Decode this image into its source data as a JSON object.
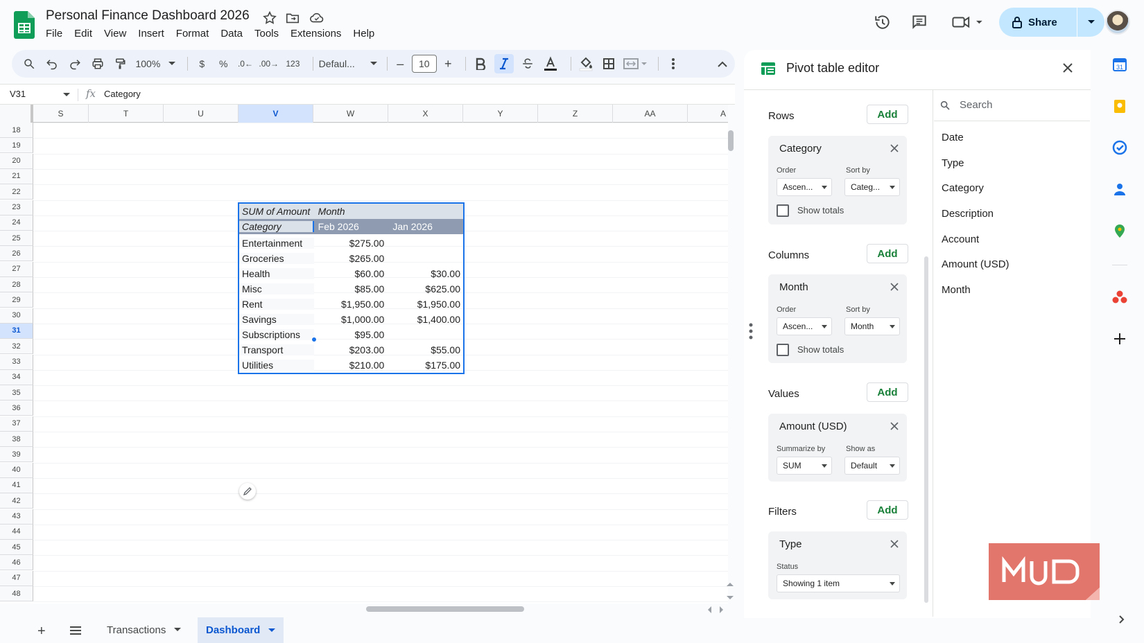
{
  "app": {
    "title": "Personal Finance Dashboard 2026",
    "menu": [
      "File",
      "Edit",
      "View",
      "Insert",
      "Format",
      "Data",
      "Tools",
      "Extensions",
      "Help"
    ],
    "share_label": "Share"
  },
  "toolbar": {
    "zoom": "100%",
    "currency": "$",
    "percent": "%",
    "dec_decrease": ".0",
    "dec_increase": ".00",
    "number_format": "123",
    "font": "Defaul...",
    "font_size": "10",
    "minus": "–",
    "plus": "+"
  },
  "formula_bar": {
    "cell_ref": "V31",
    "fx": "fx",
    "content": "Category"
  },
  "grid": {
    "columns": [
      "S",
      "T",
      "U",
      "V",
      "W",
      "X",
      "Y",
      "Z",
      "AA",
      "A"
    ],
    "selected_column": "V",
    "rows": [
      "18",
      "19",
      "20",
      "21",
      "22",
      "23",
      "24",
      "25",
      "26",
      "27",
      "28",
      "29",
      "30",
      "31",
      "32",
      "33",
      "34",
      "35",
      "36",
      "37",
      "38",
      "39",
      "40",
      "41",
      "42",
      "43",
      "44",
      "45",
      "46",
      "47",
      "48"
    ],
    "selected_row": "31"
  },
  "pivot": {
    "header1": {
      "c0": "SUM of Amount",
      "c1": "Month",
      "c2": ""
    },
    "header2": {
      "c0": "Category",
      "c1": "Feb 2026",
      "c2": "Jan 2026"
    },
    "rows": [
      {
        "category": "Entertainment",
        "feb": "$275.00",
        "jan": ""
      },
      {
        "category": "Groceries",
        "feb": "$265.00",
        "jan": ""
      },
      {
        "category": "Health",
        "feb": "$60.00",
        "jan": "$30.00"
      },
      {
        "category": "Misc",
        "feb": "$85.00",
        "jan": "$625.00"
      },
      {
        "category": "Rent",
        "feb": "$1,950.00",
        "jan": "$1,950.00"
      },
      {
        "category": "Savings",
        "feb": "$1,000.00",
        "jan": "$1,400.00"
      },
      {
        "category": "Subscriptions",
        "feb": "$95.00",
        "jan": ""
      },
      {
        "category": "Transport",
        "feb": "$203.00",
        "jan": "$55.00"
      },
      {
        "category": "Utilities",
        "feb": "$210.00",
        "jan": "$175.00"
      }
    ]
  },
  "sheets": {
    "tabs": [
      "Transactions",
      "Dashboard"
    ],
    "active": "Dashboard",
    "add": "+"
  },
  "editor": {
    "title": "Pivot table editor",
    "add_label": "Add",
    "rows": {
      "label": "Rows",
      "field": "Category",
      "order_label": "Order",
      "order": "Ascen...",
      "sort_label": "Sort by",
      "sort": "Categ...",
      "show_totals": "Show totals"
    },
    "columns": {
      "label": "Columns",
      "field": "Month",
      "order_label": "Order",
      "order": "Ascen...",
      "sort_label": "Sort by",
      "sort": "Month",
      "show_totals": "Show totals"
    },
    "values": {
      "label": "Values",
      "field": "Amount (USD)",
      "summarize_label": "Summarize by",
      "summarize": "SUM",
      "show_as_label": "Show as",
      "show_as": "Default"
    },
    "filters": {
      "label": "Filters",
      "field": "Type",
      "status_label": "Status",
      "status": "Showing 1 item"
    },
    "search_placeholder": "Search",
    "fields": [
      "Date",
      "Type",
      "Category",
      "Description",
      "Account",
      "Amount (USD)",
      "Month"
    ]
  },
  "colors": {
    "accent": "#0b57d0",
    "share_bg": "#c2e7ff",
    "add_green": "#188038",
    "selection": "#1a73e8"
  },
  "icons": [
    "sheets-logo-icon",
    "star-icon",
    "move-folder-icon",
    "cloud-status-icon",
    "history-icon",
    "comment-icon",
    "meet-icon",
    "lock-icon",
    "search-icon",
    "undo-icon",
    "redo-icon",
    "print-icon",
    "paint-format-icon",
    "bold-icon",
    "italic-icon",
    "strikethrough-icon",
    "text-color-icon",
    "fill-color-icon",
    "borders-icon",
    "merge-icon",
    "more-icon",
    "collapse-icon",
    "close-icon",
    "pivot-icon",
    "calendar-icon",
    "keep-icon",
    "tasks-icon",
    "contacts-icon",
    "maps-icon",
    "apps-icon",
    "add-icon",
    "chevron-right-icon",
    "pencil-icon",
    "watermark-logo"
  ]
}
